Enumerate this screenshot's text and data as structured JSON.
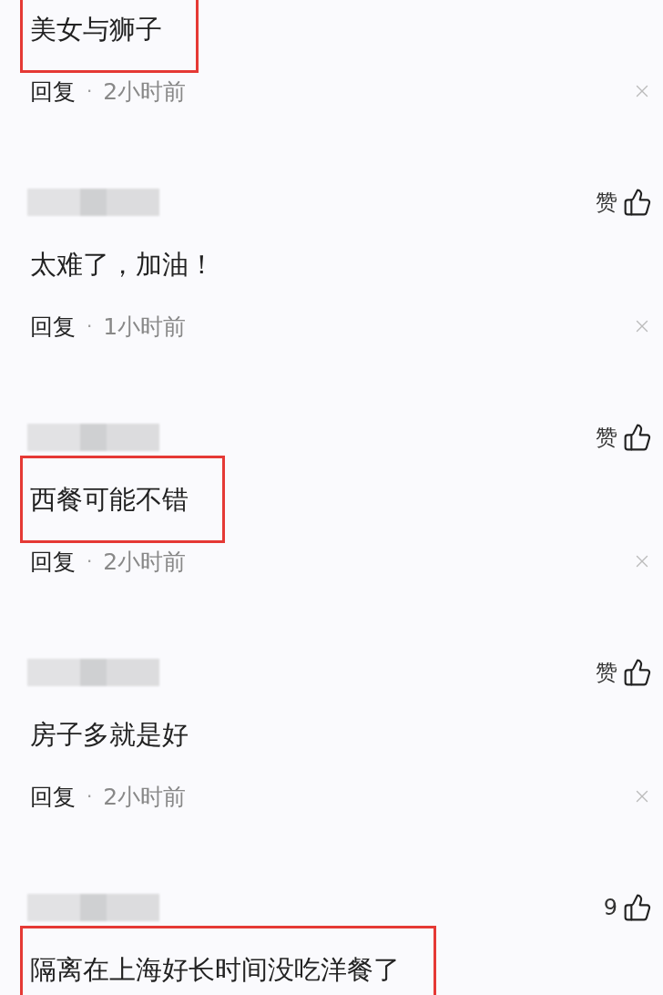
{
  "comments": [
    {
      "text": "美女与狮子",
      "highlighted": true,
      "reply": "回复",
      "separator": "·",
      "time": "2小时前"
    },
    {
      "like": "赞",
      "text": "太难了，加油！",
      "highlighted": false,
      "reply": "回复",
      "separator": "·",
      "time": "1小时前"
    },
    {
      "like": "赞",
      "text": "西餐可能不错",
      "highlighted": true,
      "reply": "回复",
      "separator": "·",
      "time": "2小时前"
    },
    {
      "like": "赞",
      "text": "房子多就是好",
      "highlighted": false,
      "reply": "回复",
      "separator": "·",
      "time": "2小时前"
    },
    {
      "like": "9",
      "text": "隔离在上海好长时间没吃洋餐了",
      "highlighted": true
    }
  ]
}
